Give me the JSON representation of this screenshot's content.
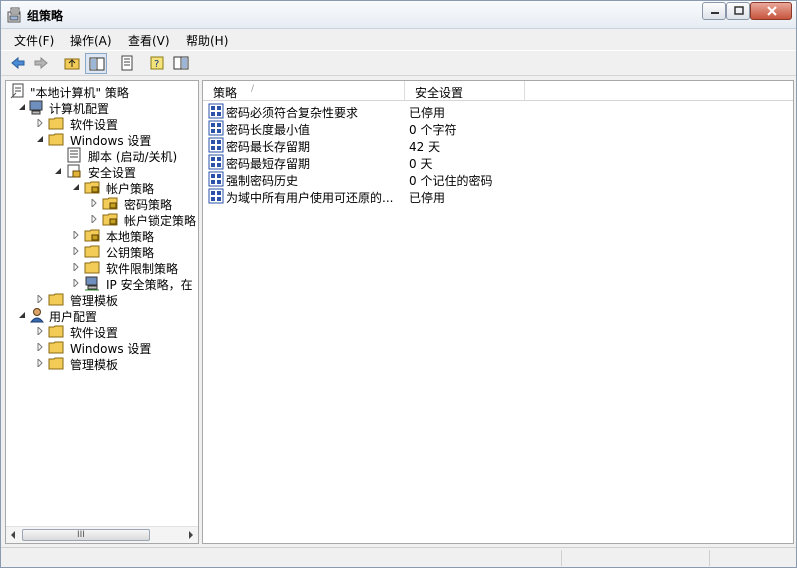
{
  "window": {
    "title": "组策略"
  },
  "menu": {
    "items": [
      "文件(F)",
      "操作(A)",
      "查看(V)",
      "帮助(H)"
    ]
  },
  "toolbar": {
    "buttons": [
      "back-arrow-icon",
      "forward-arrow-icon",
      "up-folder-icon",
      "show-hide-tree-icon",
      "properties-icon",
      "help-icon",
      "console-tree-icon"
    ]
  },
  "tree": {
    "root": "\"本地计算机\" 策略",
    "computer_config": "计算机配置",
    "software_settings": "软件设置",
    "windows_settings": "Windows 设置",
    "scripts": "脚本 (启动/关机)",
    "security_settings": "安全设置",
    "account_policies": "帐户策略",
    "password_policy": "密码策略",
    "lockout_policy": "帐户锁定策略",
    "local_policies": "本地策略",
    "public_key_policies": "公钥策略",
    "software_restriction": "软件限制策略",
    "ip_security": "IP 安全策略，在",
    "admin_templates": "管理模板",
    "user_config": "用户配置",
    "user_software_settings": "软件设置",
    "user_windows_settings": "Windows 设置",
    "user_admin_templates": "管理模板",
    "scrollbar_grip": "III"
  },
  "list": {
    "headers": {
      "policy": "策略",
      "setting": "安全设置",
      "sort_arrow": "/"
    },
    "rows": [
      {
        "policy": "密码必须符合复杂性要求",
        "setting": "已停用"
      },
      {
        "policy": "密码长度最小值",
        "setting": "0 个字符"
      },
      {
        "policy": "密码最长存留期",
        "setting": "42 天"
      },
      {
        "policy": "密码最短存留期",
        "setting": "0 天"
      },
      {
        "policy": "强制密码历史",
        "setting": "0 个记住的密码"
      },
      {
        "policy": "为域中所有用户使用可还原的...",
        "setting": "已停用"
      }
    ]
  },
  "colors": {
    "folder": "#f2cc57",
    "policy_icon": "#2b52a8",
    "accent_close": "#c7543d"
  }
}
